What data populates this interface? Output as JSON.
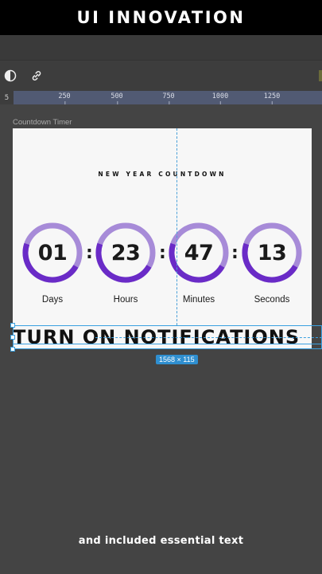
{
  "banner": {
    "title": "UI INNOVATION"
  },
  "toolbar": {
    "contrast_icon": "contrast-icon",
    "link_icon": "link-icon"
  },
  "ruler": {
    "start": "5",
    "ticks": [
      "250",
      "500",
      "750",
      "1000",
      "1250"
    ]
  },
  "frame": {
    "label": "Countdown Timer"
  },
  "countdown": {
    "title": "NEW YEAR COUNTDOWN",
    "units": [
      {
        "value": "01",
        "label": "Days"
      },
      {
        "value": "23",
        "label": "Hours"
      },
      {
        "value": "47",
        "label": "Minutes"
      },
      {
        "value": "13",
        "label": "Seconds"
      }
    ],
    "separator": ":",
    "ring_colors": {
      "light": "#a78bd8",
      "dark": "#6a2bc7"
    }
  },
  "notification": {
    "text": "TURN ON NOTIFICATIONS"
  },
  "selection": {
    "dimensions": "1568 × 115",
    "color": "#3aa0e0"
  },
  "caption": {
    "text": "and included essential text"
  }
}
